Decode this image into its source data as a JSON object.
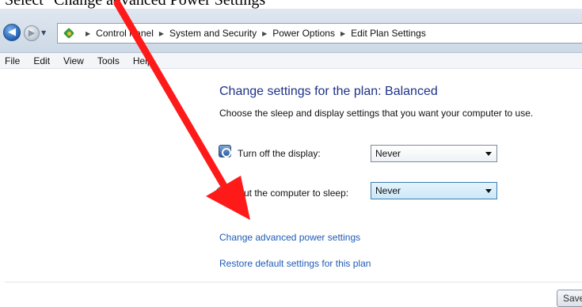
{
  "caption": {
    "text": "Select \"Change advanced Power Settings\""
  },
  "address_bar": {
    "crumbs": [
      "Control Panel",
      "System and Security",
      "Power Options",
      "Edit Plan Settings"
    ]
  },
  "menu": {
    "items": [
      "File",
      "Edit",
      "View",
      "Tools",
      "Help"
    ]
  },
  "main": {
    "title": "Change settings for the plan: Balanced",
    "subtitle": "Choose the sleep and display settings that you want your computer to use.",
    "display_setting": {
      "label": "Turn off the display:",
      "value": "Never"
    },
    "sleep_setting": {
      "label": "Put the computer to sleep:",
      "value": "Never"
    },
    "links": {
      "advanced": "Change advanced power settings",
      "restore": "Restore default settings for this plan"
    },
    "save_label": "Save changes"
  },
  "colors": {
    "title": "#1e3287",
    "link": "#1e5bb7",
    "annotation_arrow": "#ff1a1a"
  },
  "icons": {
    "back": "back-arrow-icon",
    "forward": "forward-arrow-icon",
    "control_panel": "control-panel-icon",
    "display": "display-power-icon",
    "sleep": "sleep-moon-icon"
  }
}
